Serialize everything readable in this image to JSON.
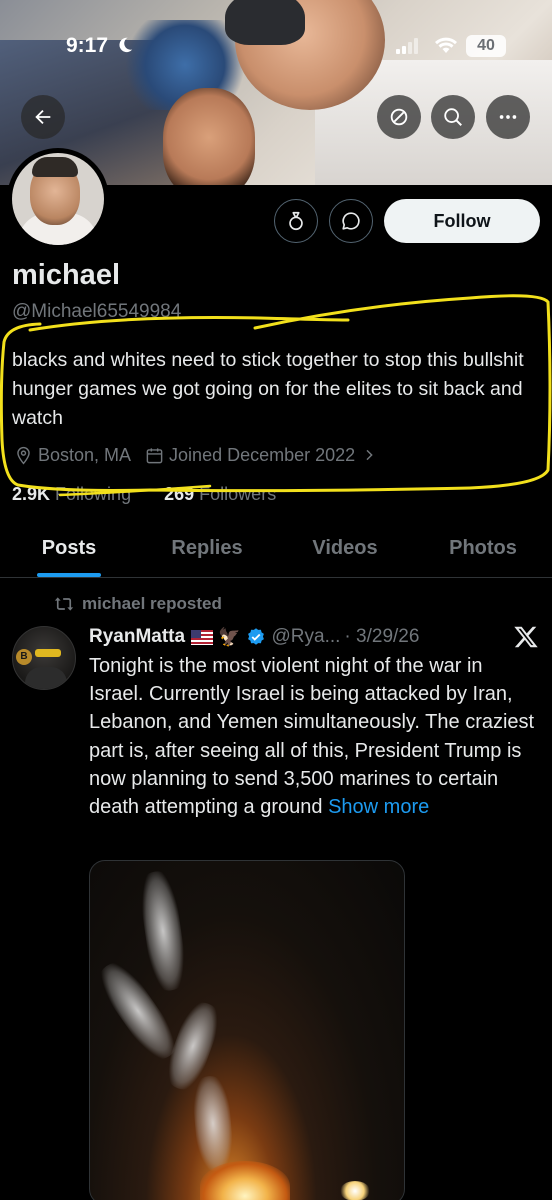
{
  "status_bar": {
    "time": "9:17",
    "battery": "40"
  },
  "profile": {
    "name": "michael",
    "handle": "@Michael65549984",
    "bio": "blacks and whites need to stick together to stop this bullshit hunger games we got going on for the elites to sit back and watch",
    "location": "Boston, MA",
    "joined": "Joined December 2022",
    "following_count": "2.9K",
    "following_label": "Following",
    "followers_count": "269",
    "followers_label": "Followers",
    "follow_button": "Follow"
  },
  "tabs": [
    {
      "label": "Posts",
      "active": true
    },
    {
      "label": "Replies",
      "active": false
    },
    {
      "label": "Videos",
      "active": false
    },
    {
      "label": "Photos",
      "active": false
    }
  ],
  "post": {
    "repost_label": "michael reposted",
    "author": "RyanMatta",
    "handle": "@Rya...",
    "date": "· 3/29/26",
    "text": "Tonight is the most violent night of the war in Israel. Currently Israel is being attacked by Iran, Lebanon, and Yemen simultaneously. The craziest part is, after seeing all of this, President Trump is now planning to send 3,500 marines to certain death attempting a ground",
    "show_more": "Show more",
    "avatar_coin": "B"
  },
  "colors": {
    "accent": "#1d9bf0",
    "background": "#000000",
    "muted": "#71767b",
    "scribble": "#f2e01c"
  },
  "icons": [
    "back-arrow-icon",
    "ban-icon",
    "search-icon",
    "more-icon",
    "gift-icon",
    "message-icon",
    "location-icon",
    "calendar-icon",
    "chevron-right-icon",
    "repost-icon",
    "verified-icon",
    "x-logo-icon"
  ]
}
